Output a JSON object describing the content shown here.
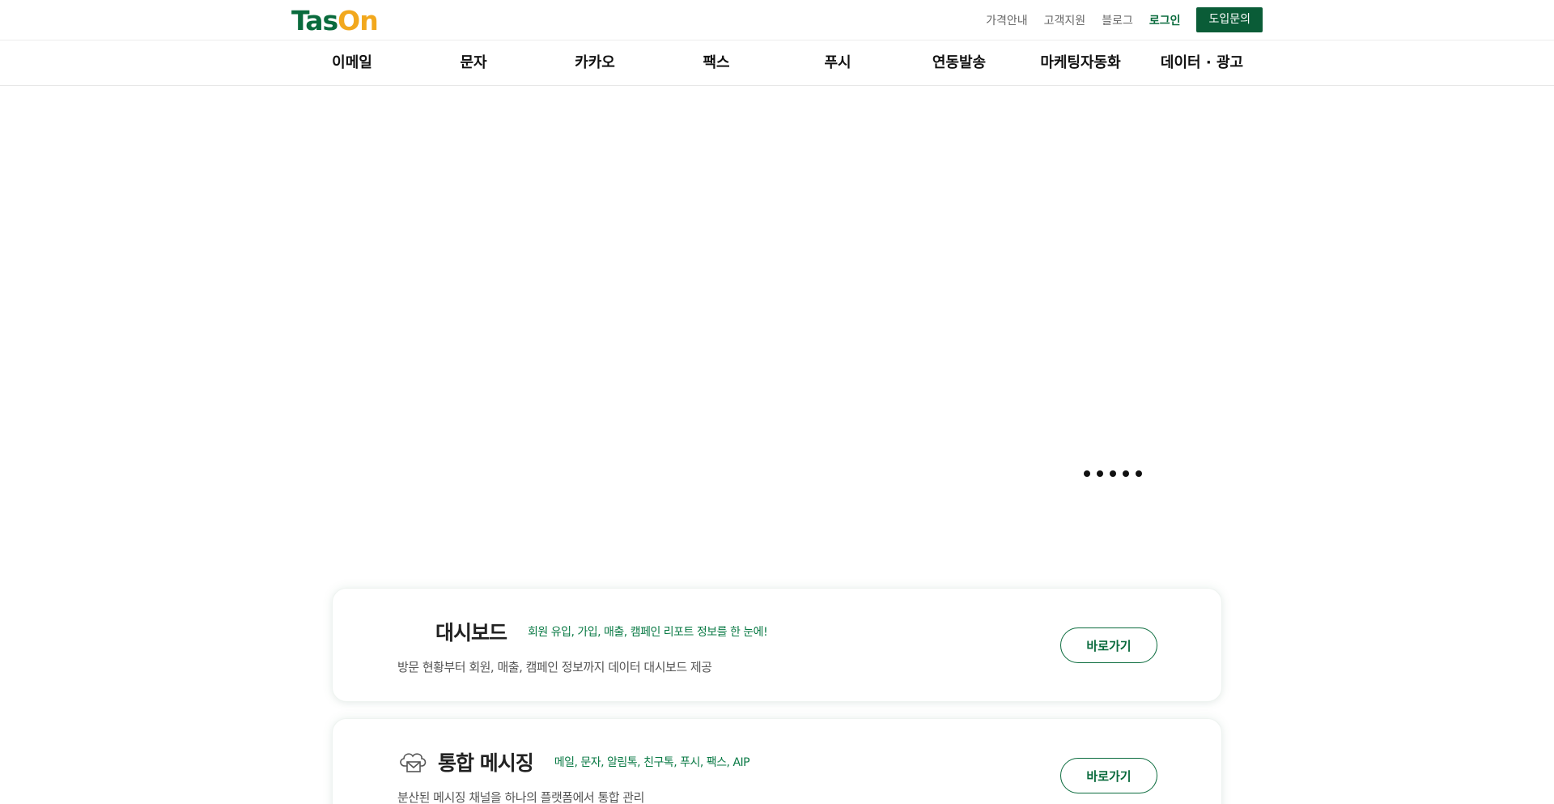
{
  "header": {
    "logo": {
      "part1": "Tas",
      "part2": "On"
    },
    "utility_links": [
      "가격안내",
      "고객지원",
      "블로그"
    ],
    "login_label": "로그인",
    "inquiry_label": "도입문의"
  },
  "gnb": {
    "items": [
      "이메일",
      "문자",
      "카카오",
      "팩스",
      "푸시",
      "연동발송",
      "마케팅자동화",
      "데이터 · 광고"
    ]
  },
  "hero": {
    "slide_count": 5
  },
  "services": [
    {
      "title": "대시보드",
      "tagline": "회원 유입, 가입, 매출, 캠페인 리포트 정보를 한 눈에!",
      "description": "방문 현황부터 회원, 매출, 캠페인 정보까지 데이터 대시보드 제공",
      "button": "바로가기"
    },
    {
      "title": "통합 메시징",
      "tagline": "메일, 문자, 알림톡, 친구톡, 푸시, 팩스, AIP",
      "description": "분산된 메시징 채널을 하나의 플랫폼에서 통합 관리",
      "button": "바로가기",
      "icon": "cloud-mail-icon"
    }
  ],
  "colors": {
    "brand_green": "#0a6b3d",
    "brand_orange": "#f2a81d"
  }
}
